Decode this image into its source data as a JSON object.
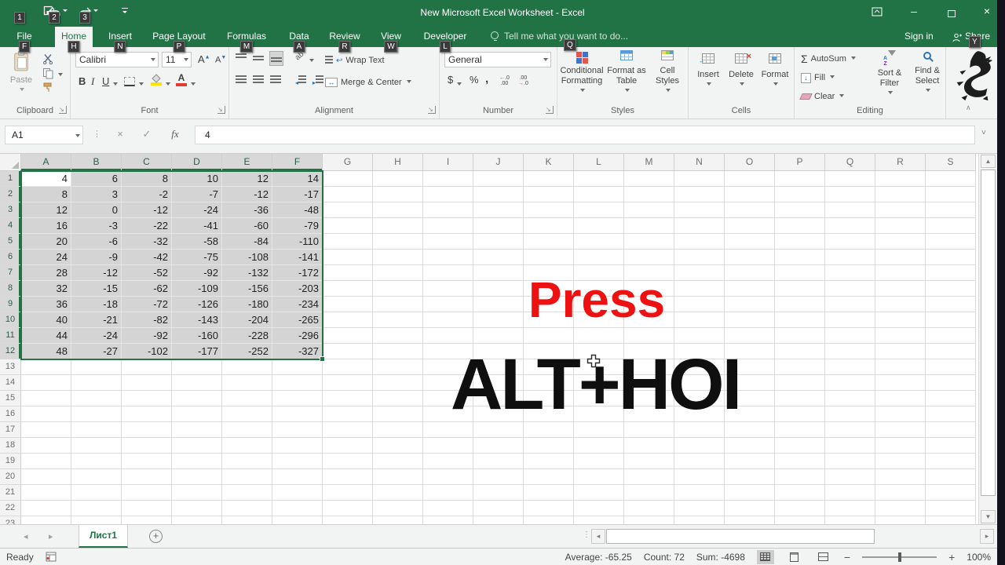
{
  "titlebar": {
    "title": "New Microsoft Excel Worksheet - Excel",
    "qat_keytips": {
      "save": "1",
      "undo": "2",
      "redo": "3"
    }
  },
  "tabs": [
    {
      "label": "File",
      "keytip": "F",
      "active": false
    },
    {
      "label": "Home",
      "keytip": "H",
      "active": true
    },
    {
      "label": "Insert",
      "keytip": "N",
      "active": false
    },
    {
      "label": "Page Layout",
      "keytip": "P",
      "active": false
    },
    {
      "label": "Formulas",
      "keytip": "M",
      "active": false
    },
    {
      "label": "Data",
      "keytip": "A",
      "active": false
    },
    {
      "label": "Review",
      "keytip": "R",
      "active": false
    },
    {
      "label": "View",
      "keytip": "W",
      "active": false
    },
    {
      "label": "Developer",
      "keytip": "L",
      "active": false
    }
  ],
  "tellme": {
    "label": "Tell me what you want to do...",
    "keytip": "Q"
  },
  "account": {
    "sign_in": "Sign in",
    "share": "Share",
    "share_keytip": "Y"
  },
  "ribbon": {
    "clipboard": {
      "label": "Clipboard",
      "paste": "Paste"
    },
    "font": {
      "label": "Font",
      "name": "Calibri",
      "size": "11",
      "bold": "B",
      "italic": "I",
      "underline": "U"
    },
    "alignment": {
      "label": "Alignment",
      "wrap": "Wrap Text",
      "merge": "Merge & Center"
    },
    "number": {
      "label": "Number",
      "format": "General",
      "currency": "$",
      "percent": "%",
      "comma": ","
    },
    "styles": {
      "label": "Styles",
      "b1": "Conditional Formatting",
      "b2": "Format as Table",
      "b3": "Cell Styles"
    },
    "cells": {
      "label": "Cells",
      "b1": "Insert",
      "b2": "Delete",
      "b3": "Format"
    },
    "editing": {
      "label": "Editing",
      "autosum_symbol": "Σ",
      "autosum": "AutoSum",
      "fill": "Fill",
      "clear": "Clear",
      "sort": "Sort & Filter",
      "find": "Find & Select"
    }
  },
  "formula_bar": {
    "name_box": "A1",
    "value": "4",
    "cancel": "×",
    "enter": "✓",
    "fx": "fx"
  },
  "grid": {
    "columns": [
      "A",
      "B",
      "C",
      "D",
      "E",
      "F",
      "G",
      "H",
      "I",
      "J",
      "K",
      "L",
      "M",
      "N",
      "O",
      "P",
      "Q",
      "R",
      "S"
    ],
    "row_count": 23,
    "selection": {
      "range": "A1:F12",
      "active_cell": "A1",
      "rows": 12,
      "cols": 6
    },
    "data": [
      [
        4,
        6,
        8,
        10,
        12,
        14
      ],
      [
        8,
        3,
        -2,
        -7,
        -12,
        -17
      ],
      [
        12,
        0,
        -12,
        -24,
        -36,
        -48
      ],
      [
        16,
        -3,
        -22,
        -41,
        -60,
        -79
      ],
      [
        20,
        -6,
        -32,
        -58,
        -84,
        -110
      ],
      [
        24,
        -9,
        -42,
        -75,
        -108,
        -141
      ],
      [
        28,
        -12,
        -52,
        -92,
        -132,
        -172
      ],
      [
        32,
        -15,
        -62,
        -109,
        -156,
        -203
      ],
      [
        36,
        -18,
        -72,
        -126,
        -180,
        -234
      ],
      [
        40,
        -21,
        -82,
        -143,
        -204,
        -265
      ],
      [
        44,
        -24,
        -92,
        -160,
        -228,
        -296
      ],
      [
        48,
        -27,
        -102,
        -177,
        -252,
        -327
      ]
    ]
  },
  "overlay": {
    "line1": "Press",
    "line2": "ALT+HOI"
  },
  "sheet_bar": {
    "active_tab": "Лист1"
  },
  "status_bar": {
    "mode": "Ready",
    "average": "Average: -65.25",
    "count": "Count: 72",
    "sum": "Sum: -4698",
    "zoom_level": "100%"
  },
  "colors": {
    "excel_green": "#217346",
    "selection_fill": "#d4d4d4",
    "overlay_red": "#ed1111",
    "overlay_black": "#0f0f0f",
    "right_edge": "#12121c"
  }
}
